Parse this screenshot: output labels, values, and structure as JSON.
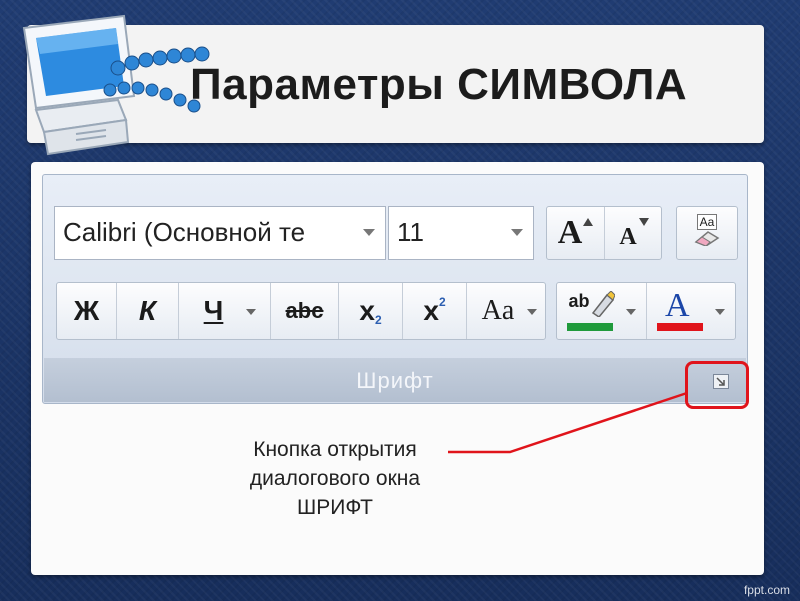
{
  "slide": {
    "title": "Параметры СИМВОЛА",
    "watermark": "fppt.com"
  },
  "ribbon": {
    "group_label": "Шрифт",
    "font_name": "Calibri (Основной те",
    "font_size": "11",
    "grow_font_label": "A",
    "shrink_font_label": "A",
    "clear_format_label": "Aa",
    "bold_label": "Ж",
    "italic_label": "К",
    "underline_label": "Ч",
    "strike_label": "abc",
    "subscript_label": "x",
    "subscript_index": "2",
    "superscript_label": "x",
    "superscript_index": "2",
    "change_case_label": "Aa",
    "highlight_label": "ab",
    "font_color_label": "A",
    "highlight_color": "#1f9a3b",
    "font_color": "#e0141b"
  },
  "callout": {
    "line1": "Кнопка открытия",
    "line2": "диалогового окна",
    "line3": "ШРИФТ"
  }
}
